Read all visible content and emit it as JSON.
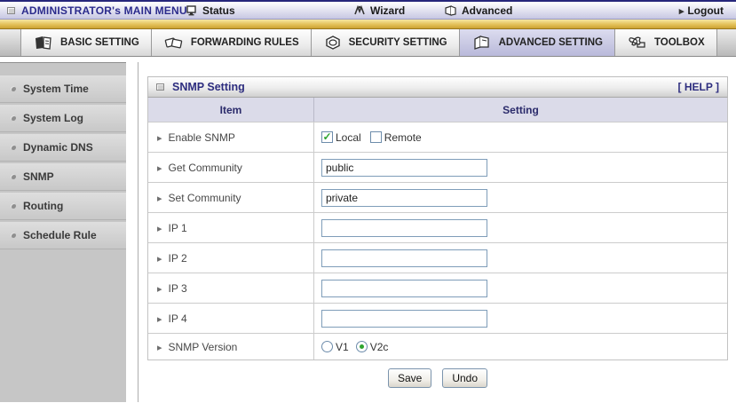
{
  "topbar": {
    "title": "ADMINISTRATOR's MAIN MENU",
    "menu": [
      {
        "label": "Status",
        "icon": "status-icon"
      },
      {
        "label": "Wizard",
        "icon": "wizard-icon"
      },
      {
        "label": "Advanced",
        "icon": "advanced-icon"
      }
    ],
    "logout": "Logout"
  },
  "tabs": [
    {
      "label": "BASIC SETTING",
      "icon": "basic-setting-icon",
      "active": false
    },
    {
      "label": "FORWARDING RULES",
      "icon": "forwarding-rules-icon",
      "active": false
    },
    {
      "label": "SECURITY SETTING",
      "icon": "security-setting-icon",
      "active": false
    },
    {
      "label": "ADVANCED SETTING",
      "icon": "advanced-setting-icon",
      "active": true
    },
    {
      "label": "TOOLBOX",
      "icon": "toolbox-icon",
      "active": false
    }
  ],
  "sidebar": {
    "items": [
      {
        "label": "System Time"
      },
      {
        "label": "System Log"
      },
      {
        "label": "Dynamic DNS"
      },
      {
        "label": "SNMP"
      },
      {
        "label": "Routing"
      },
      {
        "label": "Schedule Rule"
      }
    ],
    "active_item": "SNMP"
  },
  "panel": {
    "title": "SNMP Setting",
    "help": "[ HELP ]",
    "columns": {
      "item": "Item",
      "setting": "Setting"
    },
    "rows": {
      "enable_snmp": {
        "label": "Enable SNMP",
        "local": {
          "label": "Local",
          "checked": true
        },
        "remote": {
          "label": "Remote",
          "checked": false
        }
      },
      "get_community": {
        "label": "Get Community",
        "value": "public"
      },
      "set_community": {
        "label": "Set Community",
        "value": "private"
      },
      "ip1": {
        "label": "IP 1",
        "value": ""
      },
      "ip2": {
        "label": "IP 2",
        "value": ""
      },
      "ip3": {
        "label": "IP 3",
        "value": ""
      },
      "ip4": {
        "label": "IP 4",
        "value": ""
      },
      "snmp_version": {
        "label": "SNMP Version",
        "options": [
          {
            "label": "V1",
            "selected": false
          },
          {
            "label": "V2c",
            "selected": true
          }
        ]
      }
    },
    "buttons": {
      "save": "Save",
      "undo": "Undo"
    }
  },
  "colors": {
    "accent_navy": "#2d2d7f",
    "gold_bar": "#d9b24a",
    "active_tab": "#c7c7e2",
    "check_green": "#2fa52f",
    "input_border": "#7f9db9"
  }
}
